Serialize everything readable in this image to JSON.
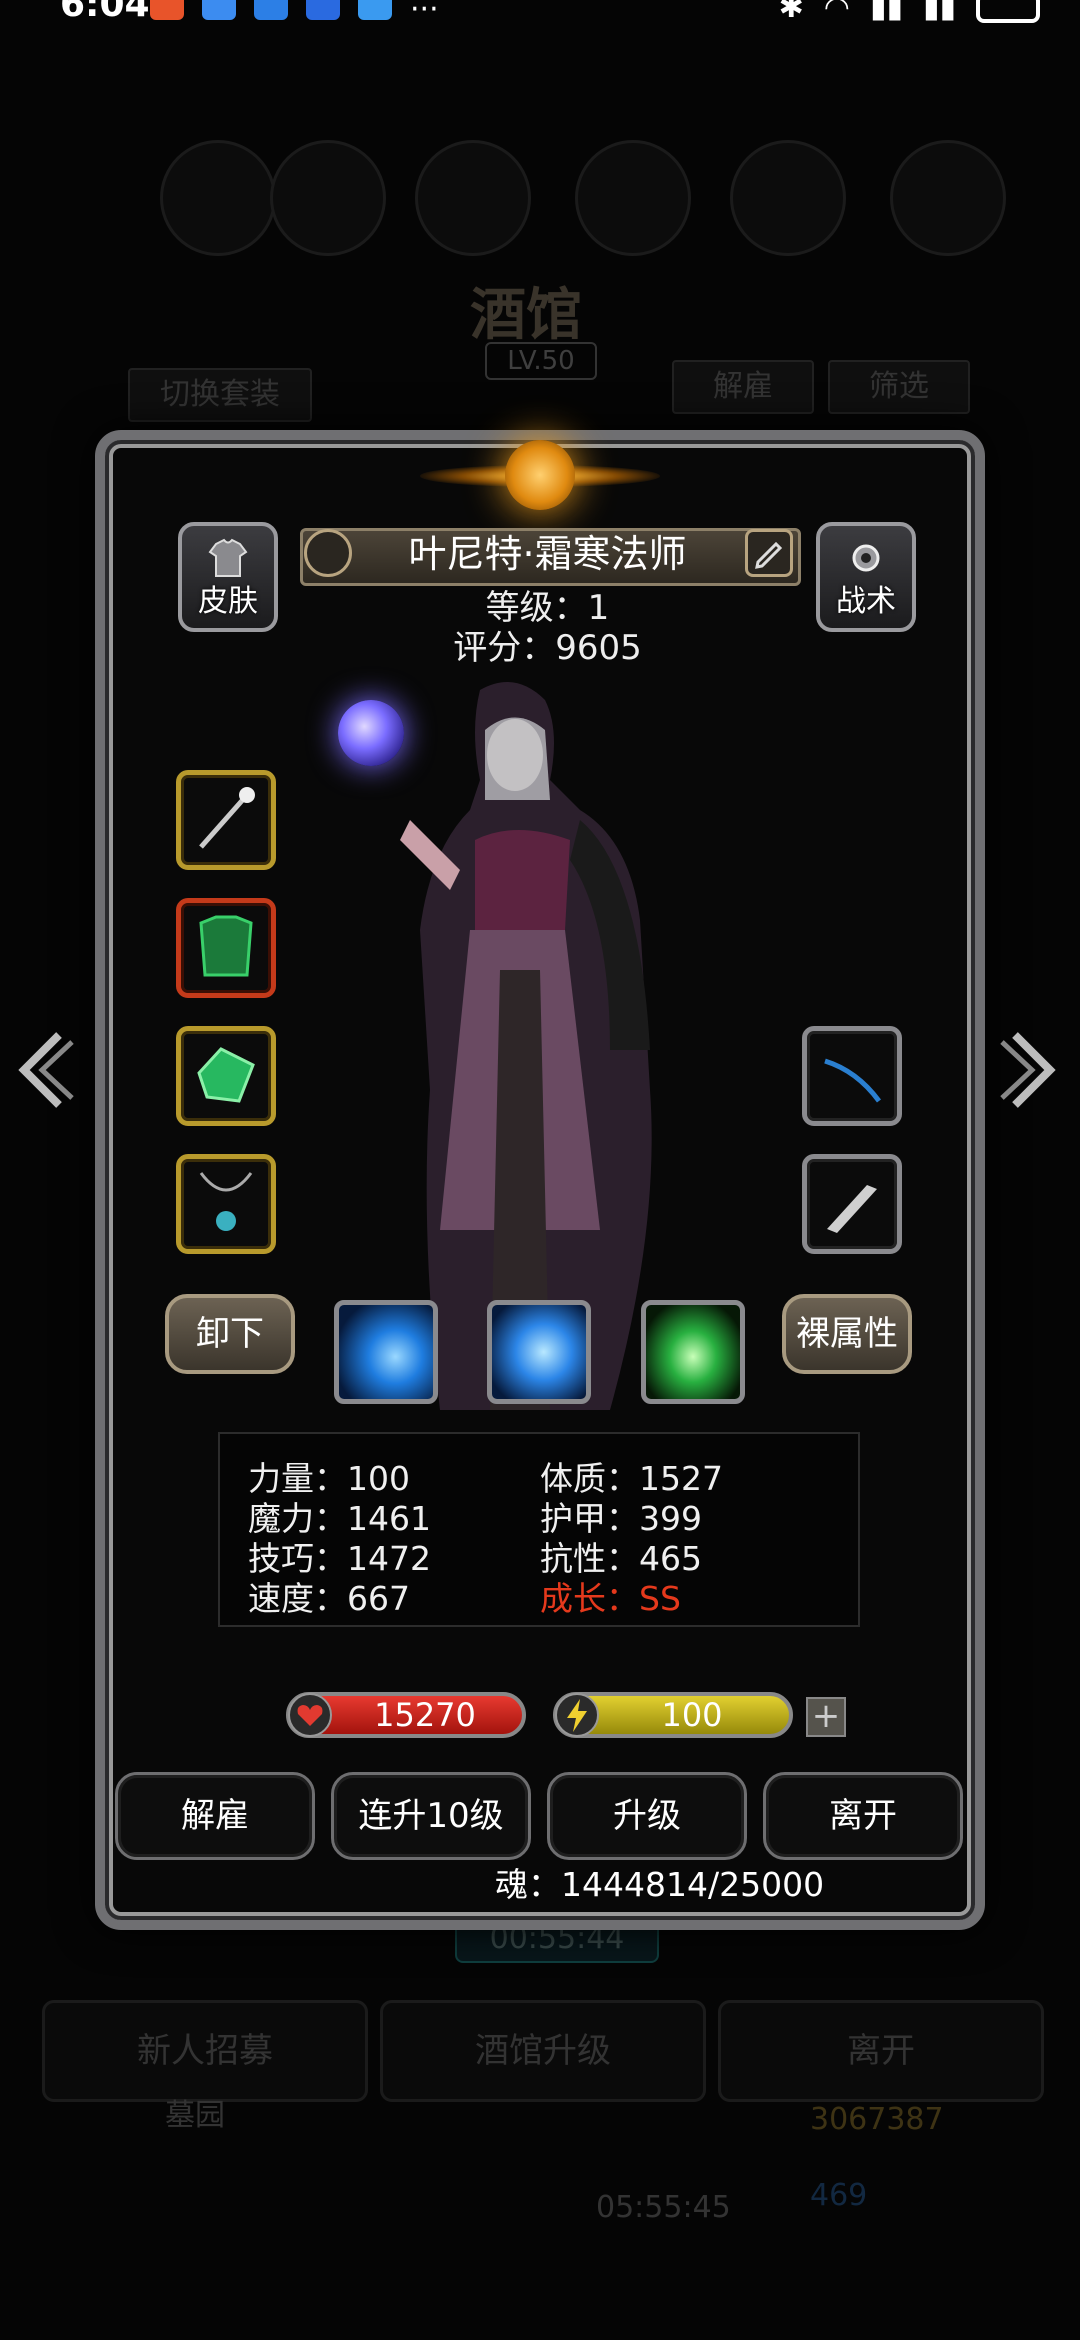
{
  "status_bar": {
    "time": "6:04",
    "more": "···"
  },
  "background": {
    "title": "酒馆",
    "level": "LV.50",
    "switch_set": "切换套装",
    "dismiss": "解雇",
    "filter": "筛选",
    "timer": "00:55:44",
    "recruit": "新人招募",
    "tavern_upgrade": "酒馆升级",
    "leave": "离开",
    "legion": "墓园",
    "gold": "3067387",
    "gems": "469",
    "countdown": "05:55:45"
  },
  "hero": {
    "name": "叶尼特·霜寒法师",
    "level": "等级：1",
    "score": "评分：9605"
  },
  "buttons": {
    "skin": "皮肤",
    "tactics": "战术",
    "unequip": "卸下",
    "base_stats": "裸属性"
  },
  "stats": {
    "strength": "力量：100",
    "magic": "魔力：1461",
    "skill": "技巧：1472",
    "speed": "速度：667",
    "constitution": "体质：1527",
    "armor": "护甲：399",
    "resistance": "抗性：465",
    "growth": "成长：SS"
  },
  "bars": {
    "hp": "15270",
    "energy": "100",
    "plus": "+"
  },
  "actions": {
    "dismiss": "解雇",
    "level_up_10": "连升10级",
    "level_up": "升级",
    "leave": "离开"
  },
  "soul": "魂：1444814/25000",
  "colors": {
    "accent_gold": "#b89a2c",
    "growth_red": "#e5391c",
    "hp_red": "#d22a20",
    "energy_yellow": "#d6c22a"
  }
}
